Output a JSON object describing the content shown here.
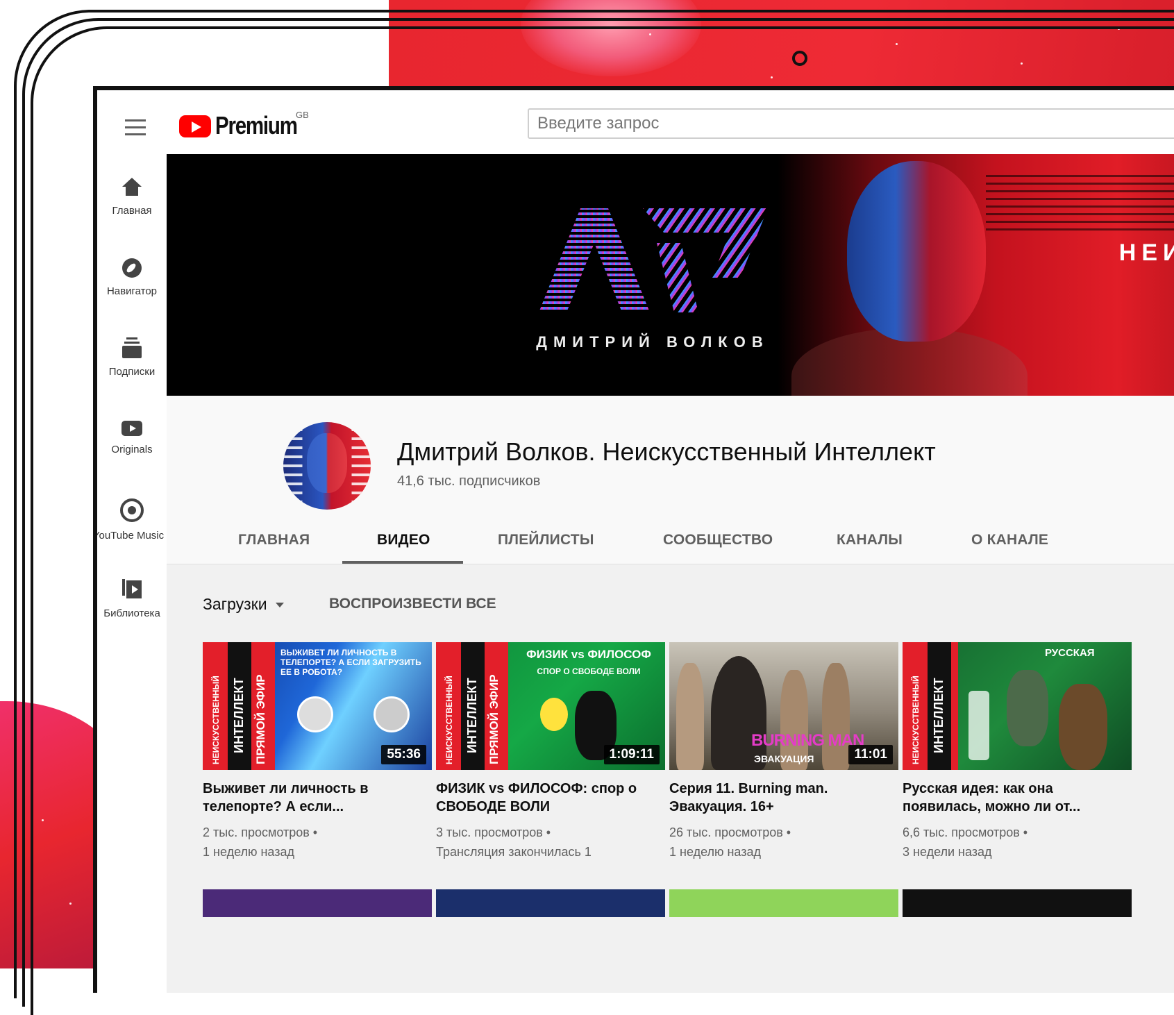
{
  "header": {
    "logo_text": "Premium",
    "logo_region": "GB",
    "search_placeholder": "Введите запрос"
  },
  "sidebar": {
    "items": [
      {
        "label": "Главная",
        "icon": "home-icon"
      },
      {
        "label": "Навигатор",
        "icon": "compass-icon"
      },
      {
        "label": "Подписки",
        "icon": "subscriptions-icon"
      },
      {
        "label": "Originals",
        "icon": "originals-icon"
      },
      {
        "label": "YouTube Music",
        "icon": "music-icon"
      },
      {
        "label": "Библиотека",
        "icon": "library-icon"
      }
    ]
  },
  "banner": {
    "name": "ДМИТРИЙ ВОЛКОВ",
    "tagline_1": "НЕИС",
    "tagline_2": "И"
  },
  "channel": {
    "title": "Дмитрий Волков. Неискусственный Интеллект",
    "subscribers": "41,6 тыс. подписчиков"
  },
  "tabs": [
    {
      "label": "ГЛАВНАЯ",
      "active": false
    },
    {
      "label": "ВИДЕО",
      "active": true
    },
    {
      "label": "ПЛЕЙЛИСТЫ",
      "active": false
    },
    {
      "label": "СООБЩЕСТВО",
      "active": false
    },
    {
      "label": "КАНАЛЫ",
      "active": false
    },
    {
      "label": "О КАНАЛЕ",
      "active": false
    }
  ],
  "filters": {
    "sort_label": "Загрузки",
    "play_all": "ВОСПРОИЗВЕСТИ ВСЕ"
  },
  "videos": [
    {
      "title": "Выживет ли личность в телепорте? А если...",
      "views": "2 тыс. просмотров •",
      "age": "1 неделю назад",
      "duration": "55:36",
      "thumb_side_1": "НЕИСКУССТВЕННЫЙ",
      "thumb_side_2": "ИНТЕЛЛЕКТ",
      "thumb_side_3": "ПРЯМОЙ ЭФИР",
      "thumb_text": "ВЫЖИВЕТ ЛИ ЛИЧНОСТЬ В ТЕЛЕПОРТЕ? А ЕСЛИ ЗАГРУЗИТЬ ЕЕ В РОБОТА?"
    },
    {
      "title": "ФИЗИК vs ФИЛОСОФ: спор о СВОБОДЕ ВОЛИ",
      "views": "3 тыс. просмотров •",
      "age": "Трансляция закончилась 1",
      "duration": "1:09:11",
      "thumb_side_1": "НЕИСКУССТВЕННЫЙ",
      "thumb_side_2": "ИНТЕЛЛЕКТ",
      "thumb_side_3": "ПРЯМОЙ ЭФИР",
      "thumb_text": "ФИЗИК vs ФИЛОСОФ",
      "thumb_subtext": "СПОР О СВОБОДЕ ВОЛИ"
    },
    {
      "title": "Серия 11. Burning man. Эвакуация. 16+",
      "views": "26 тыс. просмотров •",
      "age": "1 неделю назад",
      "duration": "11:01",
      "thumb_text": "BURNING MAN",
      "thumb_subtext": "ЭВАКУАЦИЯ"
    },
    {
      "title": "Русская идея: как она появилась, можно ли от...",
      "views": "6,6 тыс. просмотров •",
      "age": "3 недели назад",
      "thumb_side_1": "НЕИСКУССТВЕННЫЙ",
      "thumb_side_2": "ИНТЕЛЛЕКТ",
      "thumb_text": "РУССКАЯ"
    }
  ]
}
